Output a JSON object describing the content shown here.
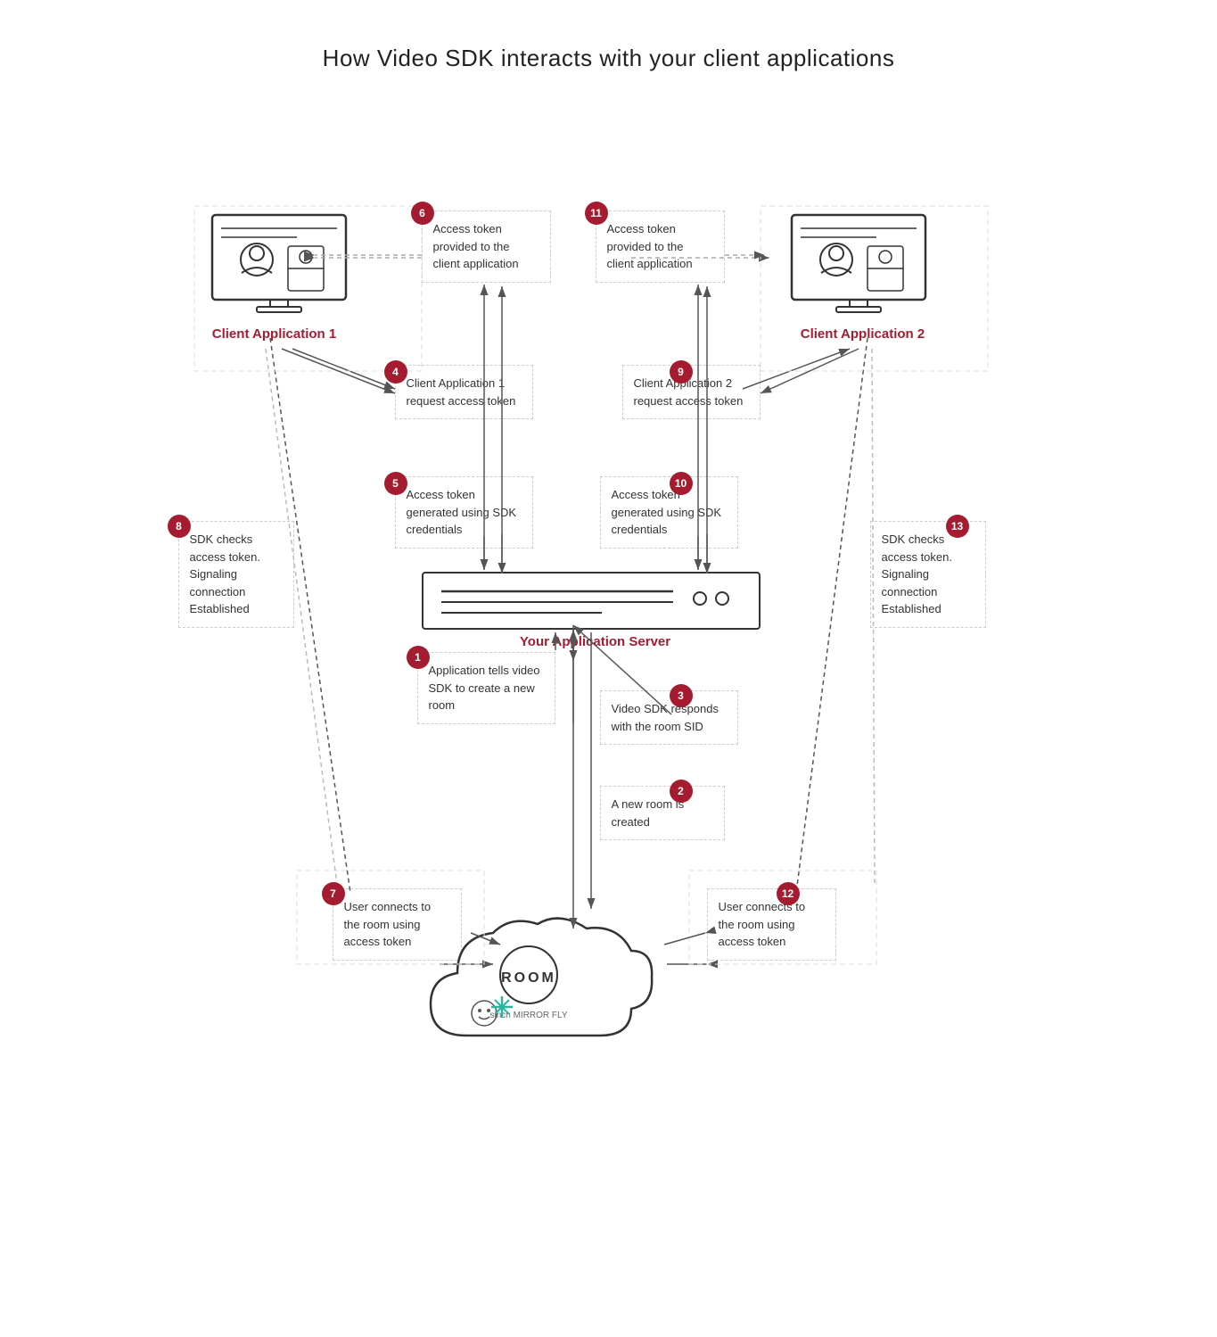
{
  "title": "How Video SDK interacts with your client applications",
  "badges": [
    1,
    2,
    3,
    4,
    5,
    6,
    7,
    8,
    9,
    10,
    11,
    12,
    13
  ],
  "client1_label": "Client Application 1",
  "client2_label": "Client Application 2",
  "server_label": "Your Application Server",
  "room_label": "ROOM",
  "sinch_text": "sinch",
  "mirror_text": "MIRROR",
  "fly_text": "FLY",
  "boxes": {
    "b6": "Access token\nprovided to the\nclient application",
    "b11": "Access token\nprovided to the\nclient application",
    "b4": "Client Application 1\nrequest access\ntoken",
    "b9": "Client Application 2\nrequest access\ntoken",
    "b5": "Access token\ngenerated using\nSDK credentials",
    "b10": "Access token\ngenerated using\nSDK credentials",
    "b8": "SDK checks\naccess token.\nSignaling\nconnection\nEstablished",
    "b13": "SDK checks\naccess token.\nSignaling\nconnection\nEstablished",
    "b1": "Application tells\nvideo SDK to create\na new room",
    "b3": "Video SDK responds\nwith the room SID",
    "b2": "A new room is\ncreated",
    "b7": "User connects to\nthe room using\naccess token",
    "b12": "User connects to\nthe room using\naccess token"
  }
}
